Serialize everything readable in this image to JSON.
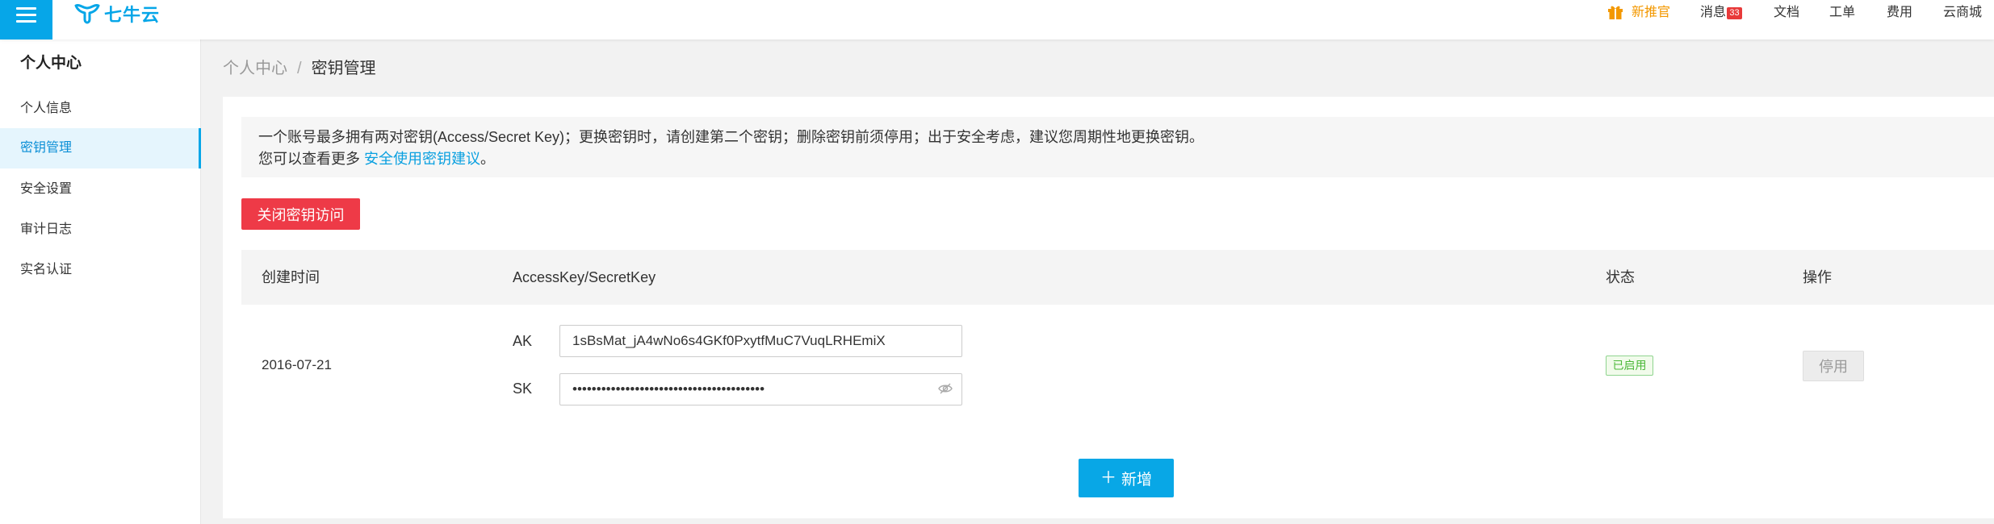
{
  "topbar": {
    "logo_text": "七牛云",
    "nav": {
      "promo": "新推官",
      "messages": "消息",
      "messages_badge": "33",
      "docs": "文档",
      "tickets": "工单",
      "billing": "费用",
      "store": "云商城"
    }
  },
  "sidebar": {
    "title": "个人中心",
    "items": [
      {
        "label": "个人信息",
        "active": false
      },
      {
        "label": "密钥管理",
        "active": true
      },
      {
        "label": "安全设置",
        "active": false
      },
      {
        "label": "审计日志",
        "active": false
      },
      {
        "label": "实名认证",
        "active": false
      }
    ]
  },
  "breadcrumb": {
    "parent": "个人中心",
    "separator": "/",
    "current": "密钥管理"
  },
  "notice": {
    "line1": "一个账号最多拥有两对密钥(Access/Secret Key)；更换密钥时，请创建第二个密钥；删除密钥前须停用；出于安全考虑，建议您周期性地更换密钥。",
    "line2_prefix": "您可以查看更多 ",
    "link": "安全使用密钥建议",
    "line2_suffix": "。"
  },
  "disable_access_button": "关闭密钥访问",
  "table": {
    "headers": {
      "created": "创建时间",
      "keys": "AccessKey/SecretKey",
      "status": "状态",
      "action": "操作"
    },
    "rows": [
      {
        "created": "2016-07-21",
        "ak_label": "AK",
        "ak_value": "1sBsMat_jA4wNo6s4GKf0PxytfMuC7VuqLRHEmiX",
        "sk_label": "SK",
        "sk_value": "••••••••••••••••••••••••••••••••••••••••",
        "status": "已启用",
        "action": "停用"
      }
    ]
  },
  "add_button": {
    "icon": "plus-icon",
    "label": "新增"
  },
  "icons": [
    "menu-icon",
    "logo-icon",
    "gift-icon",
    "eye-slash-icon",
    "plus-icon"
  ],
  "colors": {
    "accent": "#06a6e8",
    "danger": "#ee3a47",
    "promo": "#f39800",
    "success": "#4cb83a",
    "badge": "#e83a3a"
  }
}
